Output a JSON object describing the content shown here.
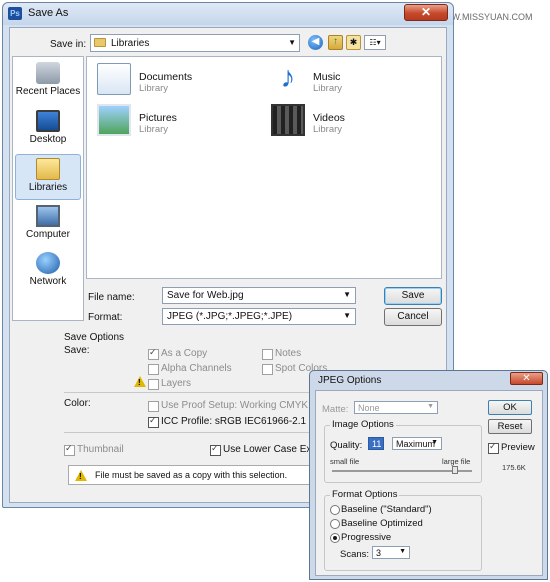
{
  "watermark": "思缘设计论坛 WWW.MISSYUAN.COM",
  "save_as": {
    "title": "Save As",
    "close_label": "✕",
    "save_in_label": "Save in:",
    "save_in_value": "Libraries",
    "places": [
      {
        "label": "Recent Places"
      },
      {
        "label": "Desktop"
      },
      {
        "label": "Libraries",
        "selected": true
      },
      {
        "label": "Computer"
      },
      {
        "label": "Network"
      }
    ],
    "libraries": [
      {
        "name": "Documents",
        "type": "Library",
        "icon": "documents-icon"
      },
      {
        "name": "Music",
        "type": "Library",
        "icon": "music-icon"
      },
      {
        "name": "Pictures",
        "type": "Library",
        "icon": "pictures-icon"
      },
      {
        "name": "Videos",
        "type": "Library",
        "icon": "videos-icon"
      }
    ],
    "file_name_label": "File name:",
    "file_name_value": "Save for Web.jpg",
    "format_label": "Format:",
    "format_value": "JPEG (*.JPG;*.JPEG;*.JPE)",
    "save_button": "Save",
    "cancel_button": "Cancel",
    "save_options": {
      "title": "Save Options",
      "save_label": "Save:",
      "as_a_copy": "As a Copy",
      "notes": "Notes",
      "alpha_channels": "Alpha Channels",
      "spot_colors": "Spot Colors",
      "layers": "Layers",
      "color_label": "Color:",
      "use_proof_setup": "Use Proof Setup:  Working CMYK",
      "icc_profile": "ICC Profile:  sRGB IEC61966-2.1",
      "thumbnail": "Thumbnail",
      "use_lower_case": "Use Lower Case Exte",
      "message": "File must be saved as a copy with this selection."
    }
  },
  "jpeg_options": {
    "title": "JPEG Options",
    "close_label": "✕",
    "matte_label": "Matte:",
    "matte_value": "None",
    "ok_button": "OK",
    "reset_button": "Reset",
    "preview_label": "Preview",
    "file_size": "175.6K",
    "image_options_title": "Image Options",
    "quality_label": "Quality:",
    "quality_value": "11",
    "quality_preset": "Maximum",
    "small_file": "small file",
    "large_file": "large file",
    "format_options_title": "Format Options",
    "baseline_standard": "Baseline (\"Standard\")",
    "baseline_optimized": "Baseline Optimized",
    "progressive": "Progressive",
    "scans_label": "Scans:",
    "scans_value": "3"
  }
}
